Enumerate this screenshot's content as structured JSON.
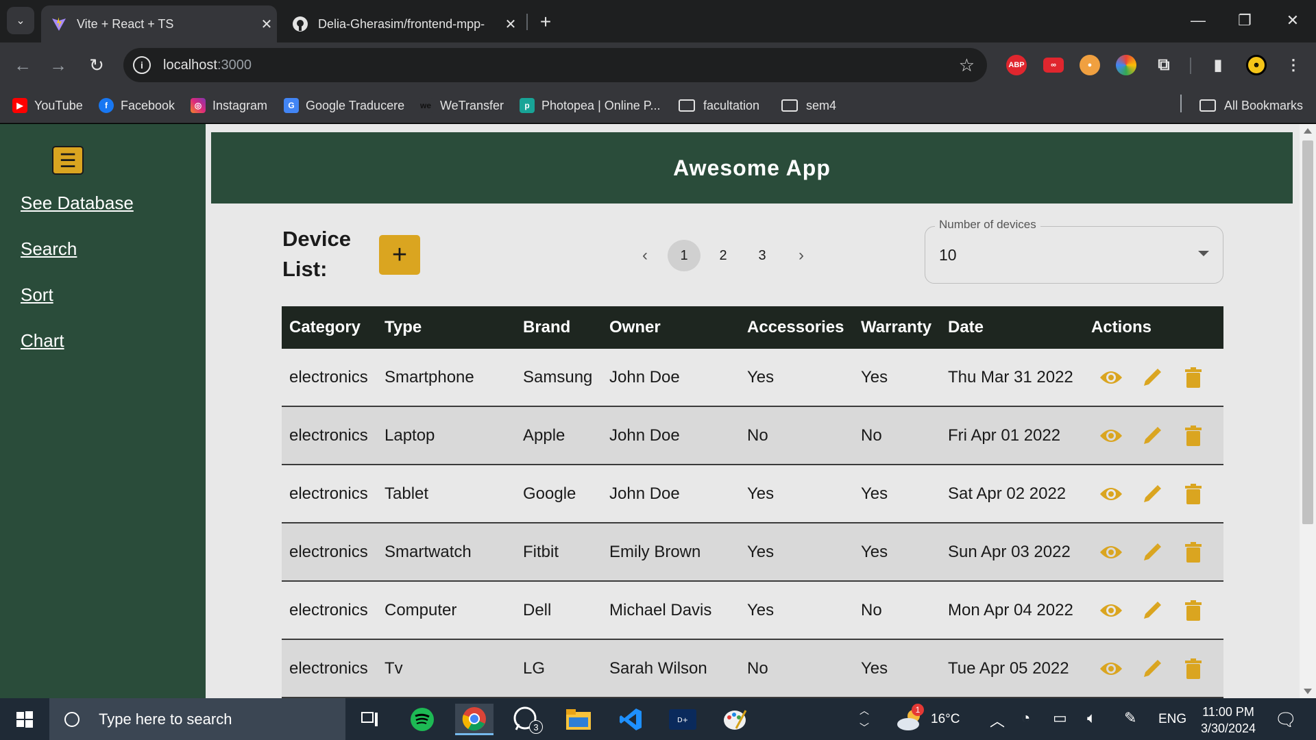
{
  "browser": {
    "tabs": [
      {
        "title": "Vite + React + TS",
        "active": true
      },
      {
        "title": "Delia-Gherasim/frontend-mpp-",
        "active": false
      }
    ],
    "address": {
      "host": "localhost",
      "port": ":3000"
    },
    "bookmarks": [
      {
        "label": "YouTube",
        "icon": "youtube-icon"
      },
      {
        "label": "Facebook",
        "icon": "facebook-icon"
      },
      {
        "label": "Instagram",
        "icon": "instagram-icon"
      },
      {
        "label": "Google Traducere",
        "icon": "google-translate-icon"
      },
      {
        "label": "WeTransfer",
        "icon": "wetransfer-icon"
      },
      {
        "label": "Photopea | Online P...",
        "icon": "photopea-icon"
      },
      {
        "label": "facultation",
        "icon": "folder-icon"
      },
      {
        "label": "sem4",
        "icon": "folder-icon"
      },
      {
        "label": "All Bookmarks",
        "icon": "folder-icon"
      }
    ],
    "extensions": {
      "abp": "ABP"
    }
  },
  "app": {
    "title": "Awesome App",
    "sidebar": {
      "menu_icon": "☰",
      "links": [
        "See Database",
        "Search",
        "Sort",
        "Chart"
      ]
    },
    "device_list_title": "Device List:",
    "add_label": "+",
    "pagination": {
      "pages": [
        "1",
        "2",
        "3"
      ],
      "current": "1"
    },
    "devices_select": {
      "label": "Number of devices",
      "value": "10"
    },
    "table": {
      "headers": [
        "Category",
        "Type",
        "Brand",
        "Owner",
        "Accessories",
        "Warranty",
        "Date",
        "Actions"
      ],
      "rows": [
        [
          "electronics",
          "Smartphone",
          "Samsung",
          "John Doe",
          "Yes",
          "Yes",
          "Thu Mar 31 2022"
        ],
        [
          "electronics",
          "Laptop",
          "Apple",
          "John Doe",
          "No",
          "No",
          "Fri Apr 01 2022"
        ],
        [
          "electronics",
          "Tablet",
          "Google",
          "John Doe",
          "Yes",
          "Yes",
          "Sat Apr 02 2022"
        ],
        [
          "electronics",
          "Smartwatch",
          "Fitbit",
          "Emily Brown",
          "Yes",
          "Yes",
          "Sun Apr 03 2022"
        ],
        [
          "electronics",
          "Computer",
          "Dell",
          "Michael Davis",
          "Yes",
          "No",
          "Mon Apr 04 2022"
        ],
        [
          "electronics",
          "Tv",
          "LG",
          "Sarah Wilson",
          "No",
          "Yes",
          "Tue Apr 05 2022"
        ]
      ]
    }
  },
  "taskbar": {
    "search_placeholder": "Type here to search",
    "whatsapp_badge": "3",
    "weather": {
      "temp": "16°C",
      "alert": "1"
    },
    "language": "ENG",
    "time": "11:00 PM",
    "date": "3/30/2024"
  },
  "colors": {
    "accent": "#daa520",
    "sidebar": "#2a4c3a",
    "header": "#1e2620"
  }
}
